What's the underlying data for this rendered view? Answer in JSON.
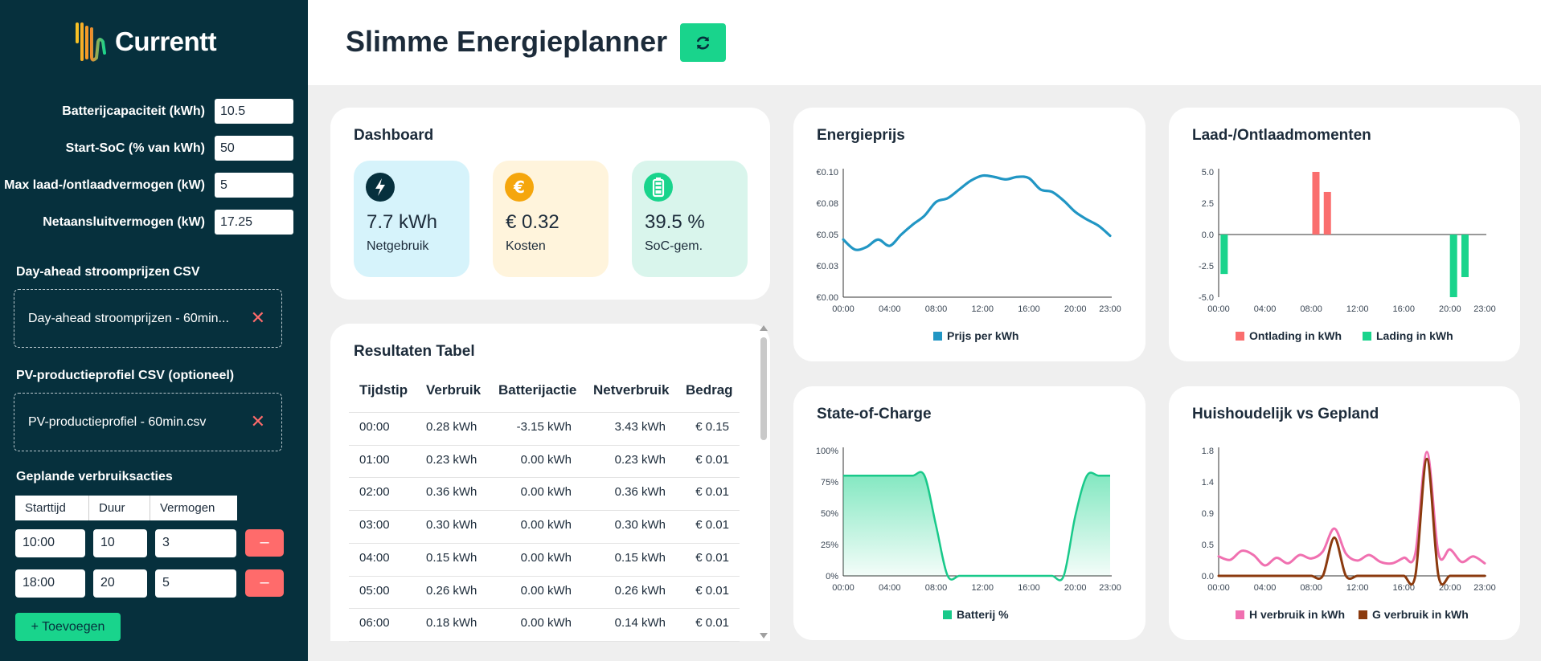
{
  "brand": {
    "name": "Currentt"
  },
  "sidebar": {
    "fields": [
      {
        "label": "Batterijcapaciteit (kWh)",
        "value": "10.5"
      },
      {
        "label": "Start-SoC (% van kWh)",
        "value": "50"
      },
      {
        "label": "Max laad-/ontlaadvermogen (kW)",
        "value": "5"
      },
      {
        "label": "Netaansluitvermogen (kW)",
        "value": "17.25"
      }
    ],
    "uploads": [
      {
        "title": "Day-ahead stroomprijzen CSV",
        "filename": "Day-ahead stroomprijzen - 60min..."
      },
      {
        "title": "PV-productieprofiel CSV (optioneel)",
        "filename": "PV-productieprofiel - 60min.csv"
      }
    ],
    "actions": {
      "title": "Geplande verbruiksacties",
      "headers": [
        "Starttijd",
        "Duur",
        "Vermogen"
      ],
      "rows": [
        {
          "start": "10:00",
          "duur": "10",
          "vermogen": "3",
          "remove": "–"
        },
        {
          "start": "18:00",
          "duur": "20",
          "vermogen": "5",
          "remove": "–"
        }
      ],
      "add_label": "+ Toevoegen"
    }
  },
  "header": {
    "title": "Slimme Energieplanner"
  },
  "dashboard": {
    "title": "Dashboard",
    "stats": [
      {
        "value": "7.7 kWh",
        "label": "Netgebruik",
        "icon": "lightning-icon",
        "bg": "#d6f3fb",
        "icon_bg": "#06303d"
      },
      {
        "value": "€ 0.32",
        "label": "Kosten",
        "icon": "euro-icon",
        "bg": "#fff4dc",
        "icon_bg": "#f5a60d"
      },
      {
        "value": "39.5 %",
        "label": "SoC-gem.",
        "icon": "battery-icon",
        "bg": "#d9f5ec",
        "icon_bg": "#19d48c"
      }
    ]
  },
  "results": {
    "title": "Resultaten Tabel",
    "headers": [
      "Tijdstip",
      "Verbruik",
      "Batterijactie",
      "Netverbruik",
      "Bedrag"
    ],
    "rows": [
      [
        "00:00",
        "0.28 kWh",
        "-3.15 kWh",
        "3.43 kWh",
        "€ 0.15"
      ],
      [
        "01:00",
        "0.23 kWh",
        "0.00 kWh",
        "0.23 kWh",
        "€ 0.01"
      ],
      [
        "02:00",
        "0.36 kWh",
        "0.00 kWh",
        "0.36 kWh",
        "€ 0.01"
      ],
      [
        "03:00",
        "0.30 kWh",
        "0.00 kWh",
        "0.30 kWh",
        "€ 0.01"
      ],
      [
        "04:00",
        "0.15 kWh",
        "0.00 kWh",
        "0.15 kWh",
        "€ 0.01"
      ],
      [
        "05:00",
        "0.26 kWh",
        "0.00 kWh",
        "0.26 kWh",
        "€ 0.01"
      ],
      [
        "06:00",
        "0.18 kWh",
        "0.00 kWh",
        "0.14 kWh",
        "€ 0.01"
      ]
    ]
  },
  "chart_data": [
    {
      "type": "line",
      "title": "Energieprijs",
      "xticks": [
        "00:00",
        "04:00",
        "08:00",
        "12:00",
        "16:00",
        "20:00",
        "23:00"
      ],
      "yticks": [
        "€0.00",
        "€0.03",
        "€0.05",
        "€0.08",
        "€0.10"
      ],
      "ylim": [
        0,
        0.1
      ],
      "x": [
        0,
        1,
        2,
        3,
        4,
        5,
        6,
        7,
        8,
        9,
        10,
        11,
        12,
        13,
        14,
        15,
        16,
        17,
        18,
        19,
        20,
        21,
        22,
        23
      ],
      "series": [
        {
          "name": "Prijs per kWh",
          "color": "#2196c4",
          "values": [
            0.046,
            0.038,
            0.04,
            0.046,
            0.041,
            0.05,
            0.058,
            0.065,
            0.076,
            0.079,
            0.086,
            0.093,
            0.097,
            0.096,
            0.094,
            0.096,
            0.095,
            0.086,
            0.084,
            0.077,
            0.068,
            0.062,
            0.057,
            0.049
          ]
        }
      ],
      "legend": "bottom"
    },
    {
      "type": "bar",
      "title": "Laad-/Ontlaadmomenten",
      "xticks": [
        "00:00",
        "04:00",
        "08:00",
        "12:00",
        "16:00",
        "20:00",
        "23:00"
      ],
      "yticks": [
        "-5.0",
        "-2.5",
        "0.0",
        "2.5",
        "5.0"
      ],
      "ylim": [
        -5,
        5
      ],
      "categories": [
        "00:00",
        "01:00",
        "02:00",
        "03:00",
        "04:00",
        "05:00",
        "06:00",
        "07:00",
        "08:00",
        "09:00",
        "10:00",
        "11:00",
        "12:00",
        "13:00",
        "14:00",
        "15:00",
        "16:00",
        "17:00",
        "18:00",
        "19:00",
        "20:00",
        "21:00",
        "22:00",
        "23:00"
      ],
      "series": [
        {
          "name": "Ontlading in kWh",
          "color": "#fa6e6e",
          "values": [
            0,
            0,
            0,
            0,
            0,
            0,
            0,
            0,
            5.0,
            3.4,
            0,
            0,
            0,
            0,
            0,
            0,
            0,
            0,
            0,
            0,
            0,
            0,
            0,
            0
          ]
        },
        {
          "name": "Lading in kWh",
          "color": "#19d48c",
          "values": [
            -3.15,
            0,
            0,
            0,
            0,
            0,
            0,
            0,
            0,
            0,
            0,
            0,
            0,
            0,
            0,
            0,
            0,
            0,
            0,
            0,
            -5.0,
            -3.4,
            0,
            0
          ]
        }
      ],
      "legend": "bottom"
    },
    {
      "type": "area",
      "title": "State-of-Charge",
      "xticks": [
        "00:00",
        "04:00",
        "08:00",
        "12:00",
        "16:00",
        "20:00",
        "23:00"
      ],
      "yticks": [
        "0%",
        "25%",
        "50%",
        "75%",
        "100%"
      ],
      "ylim": [
        0,
        100
      ],
      "x": [
        0,
        1,
        2,
        3,
        4,
        5,
        6,
        7,
        8,
        9,
        10,
        11,
        12,
        13,
        14,
        15,
        16,
        17,
        18,
        19,
        20,
        21,
        22,
        23
      ],
      "series": [
        {
          "name": "Batterij %",
          "color": "#19c98a",
          "values": [
            80,
            80,
            80,
            80,
            80,
            80,
            80,
            80,
            40,
            0,
            0,
            0,
            0,
            0,
            0,
            0,
            0,
            0,
            0,
            0,
            48,
            80,
            80,
            80
          ]
        }
      ],
      "legend": "bottom"
    },
    {
      "type": "line",
      "title": "Huishoudelijk vs Gepland",
      "xticks": [
        "00:00",
        "04:00",
        "08:00",
        "12:00",
        "16:00",
        "20:00",
        "23:00"
      ],
      "yticks": [
        "0.0",
        "0.5",
        "0.9",
        "1.4",
        "1.8"
      ],
      "ylim": [
        0,
        1.8
      ],
      "x": [
        0,
        1,
        2,
        3,
        4,
        5,
        6,
        7,
        8,
        9,
        10,
        11,
        12,
        13,
        14,
        15,
        16,
        17,
        18,
        19,
        20,
        21,
        22,
        23
      ],
      "series": [
        {
          "name": "H verbruik in kWh",
          "color": "#f070b0",
          "values": [
            0.28,
            0.23,
            0.36,
            0.3,
            0.15,
            0.26,
            0.18,
            0.3,
            0.25,
            0.35,
            0.68,
            0.32,
            0.22,
            0.3,
            0.2,
            0.18,
            0.26,
            0.32,
            1.78,
            0.32,
            0.38,
            0.2,
            0.28,
            0.18
          ]
        },
        {
          "name": "G verbruik in kWh",
          "color": "#8b3a0e",
          "values": [
            0,
            0,
            0,
            0,
            0,
            0,
            0,
            0,
            0,
            0,
            0.55,
            0,
            0,
            0,
            0,
            0,
            0,
            0,
            1.68,
            0,
            0,
            0,
            0,
            0
          ]
        }
      ],
      "legend": "bottom"
    }
  ]
}
